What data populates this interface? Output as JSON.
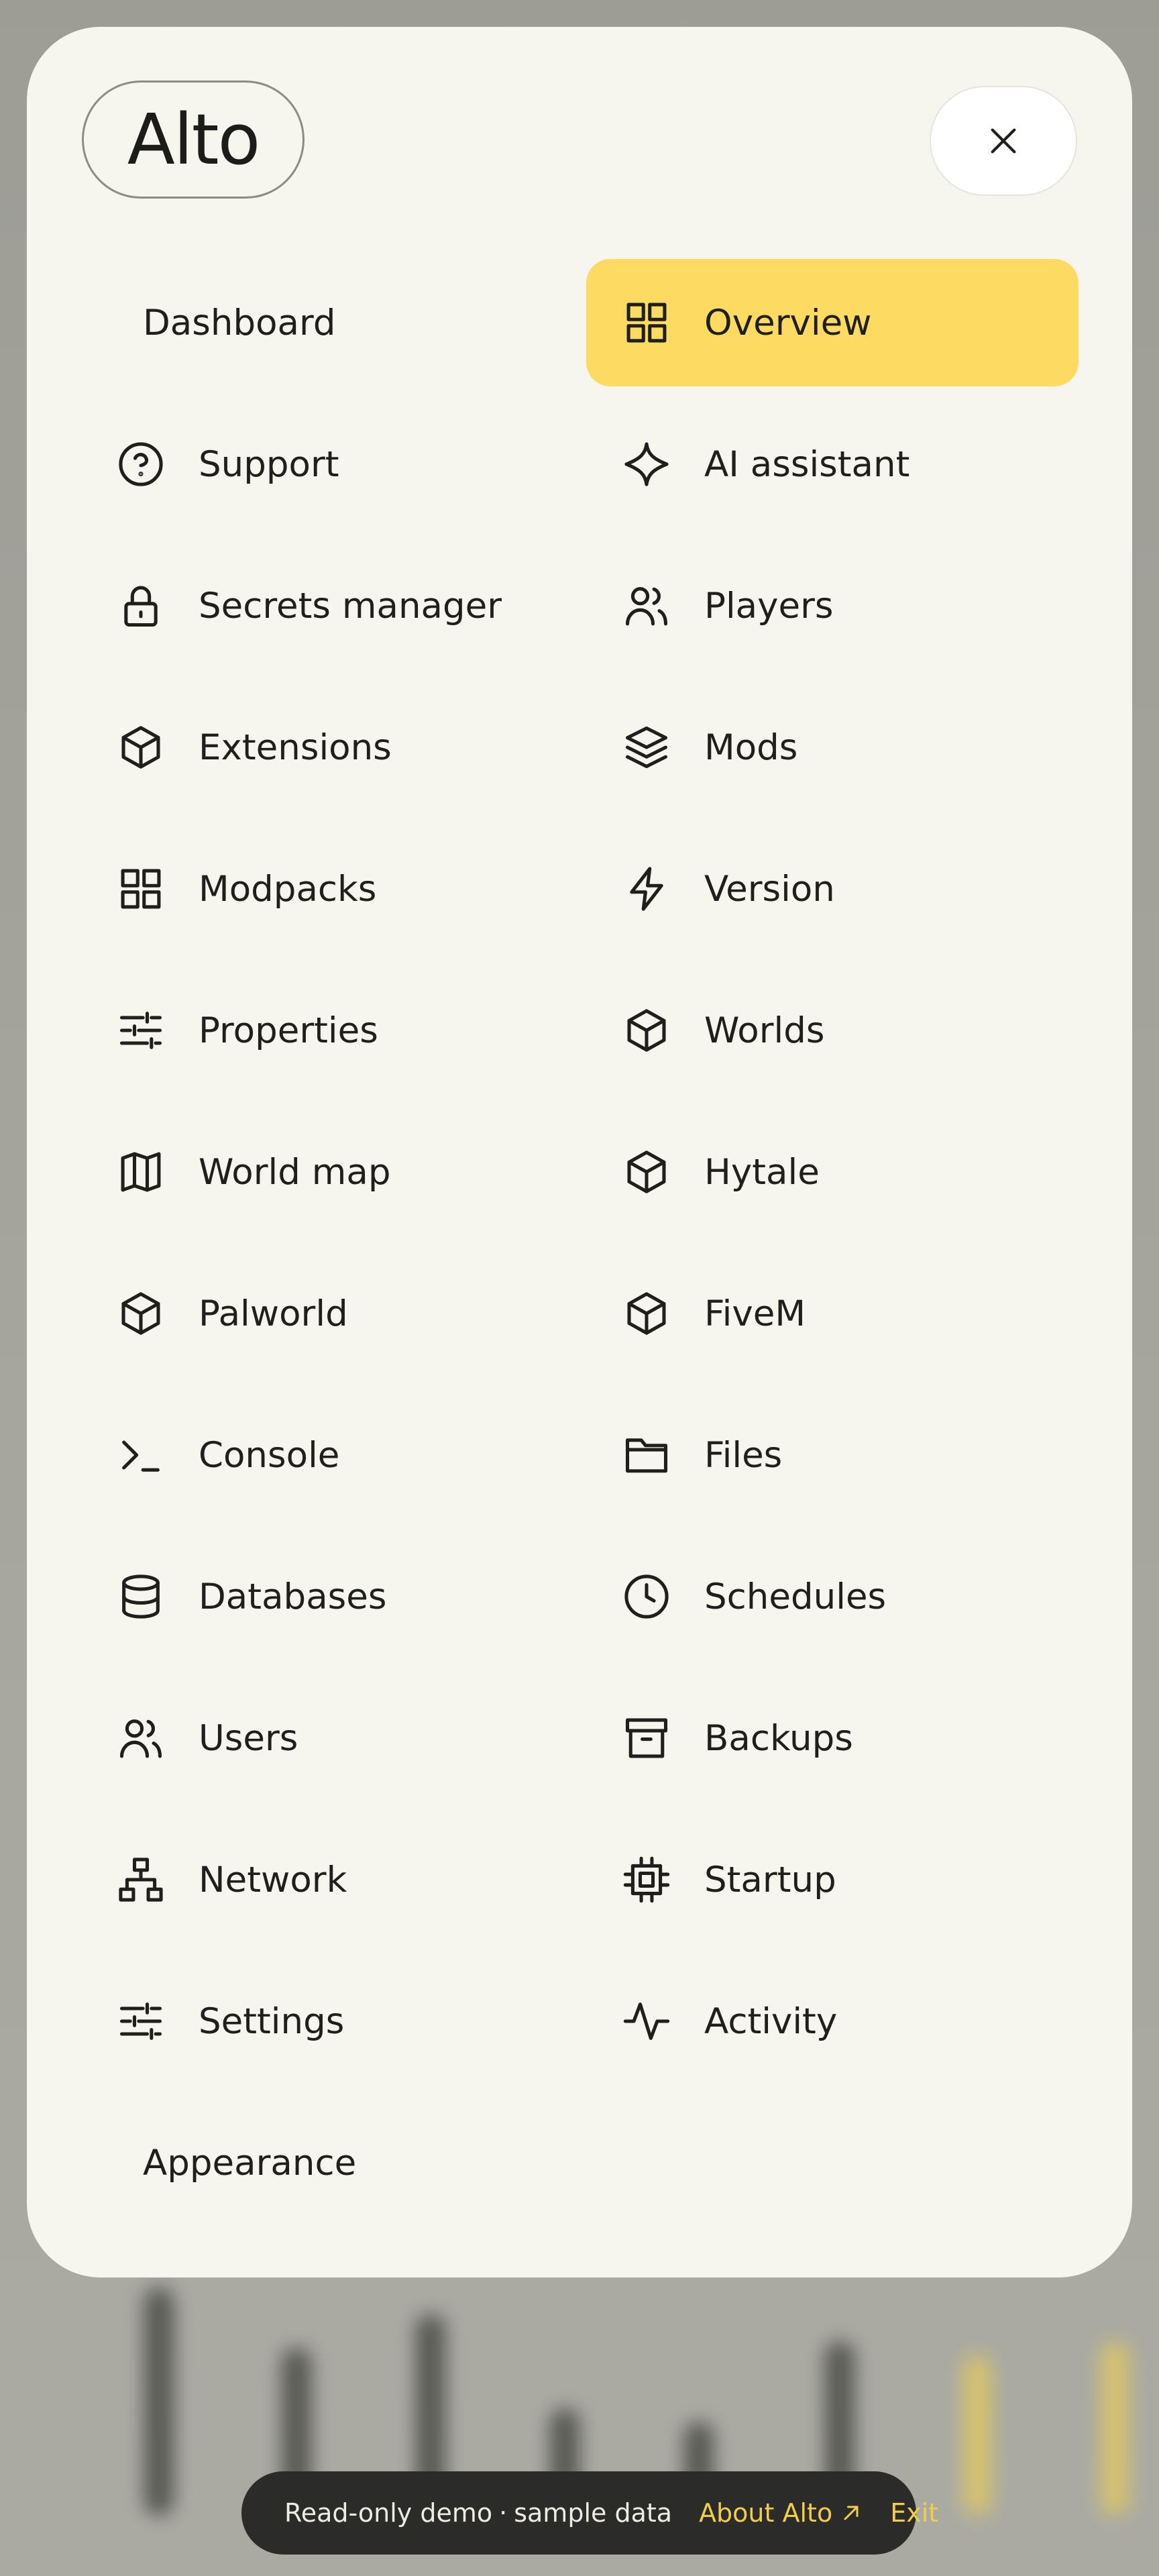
{
  "app": {
    "logo": "Alto",
    "close_label": "Close menu"
  },
  "menu": {
    "left": [
      {
        "label": "Dashboard",
        "icon": "none",
        "section": true
      },
      {
        "label": "Support",
        "icon": "help-circle-icon"
      },
      {
        "label": "Secrets manager",
        "icon": "lock-icon"
      },
      {
        "label": "Extensions",
        "icon": "box-icon"
      },
      {
        "label": "Modpacks",
        "icon": "grid-icon"
      },
      {
        "label": "Properties",
        "icon": "sliders-icon"
      },
      {
        "label": "World map",
        "icon": "map-icon"
      },
      {
        "label": "Palworld",
        "icon": "box-icon"
      },
      {
        "label": "Console",
        "icon": "terminal-icon"
      },
      {
        "label": "Databases",
        "icon": "database-icon"
      },
      {
        "label": "Users",
        "icon": "users-icon"
      },
      {
        "label": "Network",
        "icon": "network-icon"
      },
      {
        "label": "Settings",
        "icon": "sliders-icon"
      },
      {
        "label": "Appearance",
        "icon": "none",
        "section": true
      }
    ],
    "right": [
      {
        "label": "Overview",
        "icon": "grid-icon",
        "active": true
      },
      {
        "label": "AI assistant",
        "icon": "sparkle-icon"
      },
      {
        "label": "Players",
        "icon": "users-icon"
      },
      {
        "label": "Mods",
        "icon": "layers-icon"
      },
      {
        "label": "Version",
        "icon": "zap-icon"
      },
      {
        "label": "Worlds",
        "icon": "box-icon"
      },
      {
        "label": "Hytale",
        "icon": "box-icon"
      },
      {
        "label": "FiveM",
        "icon": "box-icon"
      },
      {
        "label": "Files",
        "icon": "folder-icon"
      },
      {
        "label": "Schedules",
        "icon": "clock-icon"
      },
      {
        "label": "Backups",
        "icon": "archive-icon"
      },
      {
        "label": "Startup",
        "icon": "cpu-icon"
      },
      {
        "label": "Activity",
        "icon": "activity-icon"
      }
    ]
  },
  "demo_bar": {
    "text": "Read-only demo",
    "separator": "·",
    "text2": "sample data",
    "about": "About Alto",
    "exit": "Exit"
  },
  "colors": {
    "panel": "#f6f5ee",
    "active": "#fddb63",
    "accent_link": "#f2cd4a",
    "demo_bar": "#2b2b29"
  }
}
